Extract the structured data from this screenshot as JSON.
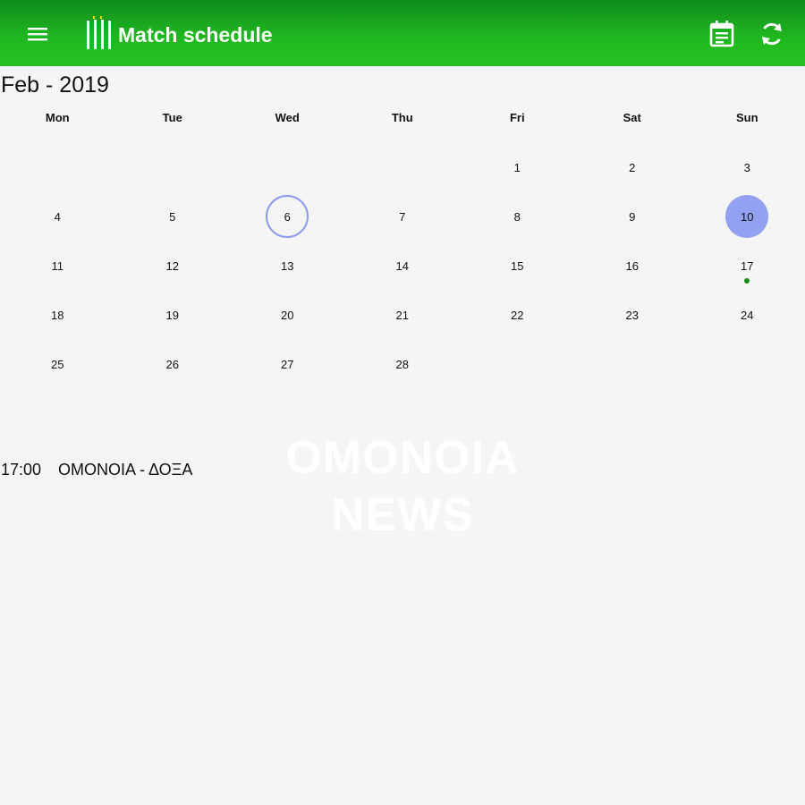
{
  "app_bar": {
    "title": "Match schedule",
    "icons": {
      "menu": "hamburger-menu-icon",
      "logo": "team-stripes-logo",
      "calendar": "calendar-note-icon",
      "refresh": "refresh-icon"
    },
    "colors": {
      "top": "#0f8a1f",
      "bottom": "#27c024",
      "foreground": "#ffffff"
    }
  },
  "calendar": {
    "month_label": "Feb - 2019",
    "weekdays": [
      "Mon",
      "Tue",
      "Wed",
      "Thu",
      "Fri",
      "Sat",
      "Sun"
    ],
    "first_weekday_index": 4,
    "days_in_month": 28,
    "today": 6,
    "selected": 10,
    "event_days": [
      17
    ],
    "colors": {
      "today_ring": "#8a9cf2",
      "selected_fill": "#92a1f2",
      "event_dot": "#1a8a1a"
    }
  },
  "watermark": {
    "line1": "OMONOIA",
    "line2": "NEWS"
  },
  "matches": [
    {
      "time": "17:00",
      "teams": "ΟΜΟΝΟΙΑ - ΔΟΞΑ"
    }
  ]
}
